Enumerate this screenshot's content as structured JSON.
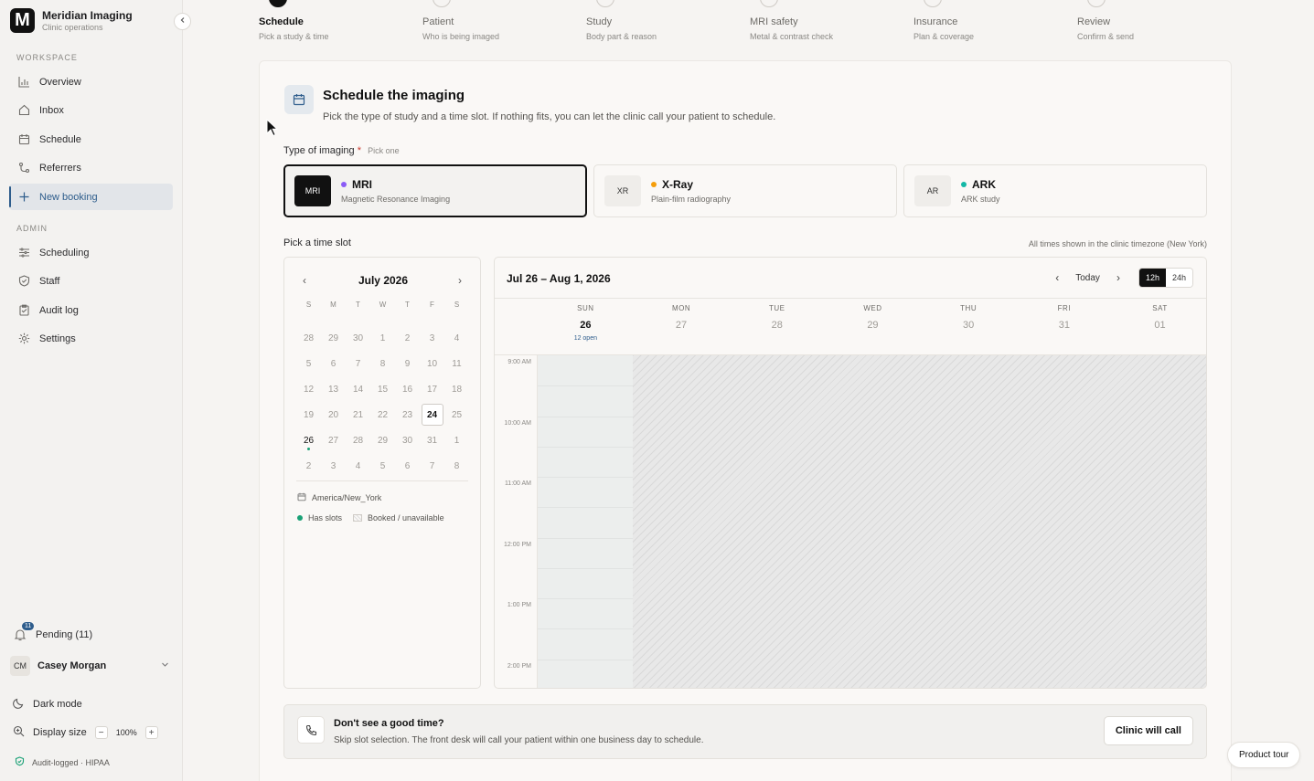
{
  "brand": {
    "name": "Meridian Imaging",
    "subtitle": "Clinic operations",
    "logo_letter": "M"
  },
  "sidebar": {
    "workspace_label": "WORKSPACE",
    "workspace_items": [
      {
        "label": "Overview",
        "icon": "chart-icon"
      },
      {
        "label": "Inbox",
        "icon": "home-icon"
      },
      {
        "label": "Schedule",
        "icon": "calendar-icon"
      },
      {
        "label": "Referrers",
        "icon": "link-icon"
      },
      {
        "label": "New booking",
        "icon": "plus-icon",
        "active": true
      }
    ],
    "admin_label": "ADMIN",
    "admin_items": [
      {
        "label": "Scheduling",
        "icon": "sliders-icon"
      },
      {
        "label": "Staff",
        "icon": "shield-icon"
      },
      {
        "label": "Audit log",
        "icon": "clipboard-icon"
      },
      {
        "label": "Settings",
        "icon": "gear-icon"
      }
    ],
    "pending_label": "Pending (11)",
    "pending_count": "11",
    "user": {
      "initials": "CM",
      "name": "Casey Morgan"
    },
    "dark_mode_label": "Dark mode",
    "display_size_label": "Display size",
    "zoom_value": "100%",
    "zoom_minus": "−",
    "zoom_plus": "+",
    "hipaa_label": "Audit-logged · HIPAA"
  },
  "stepper": [
    {
      "title": "Schedule",
      "sub": "Pick a study & time",
      "active": true
    },
    {
      "title": "Patient",
      "sub": "Who is being imaged"
    },
    {
      "title": "Study",
      "sub": "Body part & reason"
    },
    {
      "title": "MRI safety",
      "sub": "Metal & contrast check"
    },
    {
      "title": "Insurance",
      "sub": "Plan & coverage"
    },
    {
      "title": "Review",
      "sub": "Confirm & send"
    }
  ],
  "header": {
    "title": "Schedule the imaging",
    "description": "Pick the type of study and a time slot. If nothing fits, you can let the clinic call your patient to schedule."
  },
  "imaging": {
    "label": "Type of imaging",
    "required_mark": "*",
    "hint": "Pick one",
    "options": [
      {
        "abbr": "MRI",
        "name": "MRI",
        "sub": "Magnetic Resonance Imaging",
        "color": "#8b5cf6",
        "selected": true
      },
      {
        "abbr": "XR",
        "name": "X-Ray",
        "sub": "Plain-film radiography",
        "color": "#f59e0b"
      },
      {
        "abbr": "AR",
        "name": "ARK",
        "sub": "ARK study",
        "color": "#14b8a6"
      }
    ]
  },
  "timeslot": {
    "label": "Pick a time slot",
    "tz_note": "All times shown in the clinic timezone (New York)"
  },
  "mini_calendar": {
    "month_label": "July 2026",
    "prev": "‹",
    "next": "›",
    "dow": [
      "S",
      "M",
      "T",
      "W",
      "T",
      "F",
      "S"
    ],
    "weeks": [
      [
        "28",
        "29",
        "30",
        "1",
        "2",
        "3",
        "4"
      ],
      [
        "5",
        "6",
        "7",
        "8",
        "9",
        "10",
        "11"
      ],
      [
        "12",
        "13",
        "14",
        "15",
        "16",
        "17",
        "18"
      ],
      [
        "19",
        "20",
        "21",
        "22",
        "23",
        "24",
        "25"
      ],
      [
        "26",
        "27",
        "28",
        "29",
        "30",
        "31",
        "1"
      ],
      [
        "2",
        "3",
        "4",
        "5",
        "6",
        "7",
        "8"
      ]
    ],
    "today": "24",
    "selected": "26",
    "timezone": "America/New_York",
    "legend_slots": "Has slots",
    "legend_booked": "Booked / unavailable"
  },
  "week_view": {
    "range": "Jul 26 – Aug 1, 2026",
    "today_label": "Today",
    "prev": "‹",
    "next": "›",
    "format_12h": "12h",
    "format_24h": "24h",
    "days": [
      {
        "dow": "SUN",
        "num": "26",
        "open": "12 open"
      },
      {
        "dow": "MON",
        "num": "27"
      },
      {
        "dow": "TUE",
        "num": "28"
      },
      {
        "dow": "WED",
        "num": "29"
      },
      {
        "dow": "THU",
        "num": "30"
      },
      {
        "dow": "FRI",
        "num": "31"
      },
      {
        "dow": "SAT",
        "num": "01"
      }
    ],
    "times": [
      "9:00 AM",
      "10:00 AM",
      "11:00 AM",
      "12:00 PM",
      "1:00 PM",
      "2:00 PM"
    ]
  },
  "call_card": {
    "title": "Don't see a good time?",
    "description": "Skip slot selection. The front desk will call your patient within one business day to schedule.",
    "button": "Clinic will call"
  },
  "product_tour": "Product tour",
  "colors": {
    "accent": "#2e5d8c",
    "has_slots": "#1aa176",
    "dark": "#111111"
  }
}
